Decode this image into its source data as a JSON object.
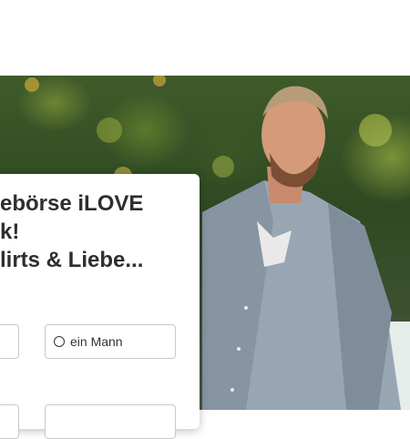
{
  "hero": {
    "headline_lines": [
      "ebörse iLOVE",
      "k!",
      "lirts & Liebe..."
    ]
  },
  "form": {
    "gender_option_man": "ein Mann"
  }
}
